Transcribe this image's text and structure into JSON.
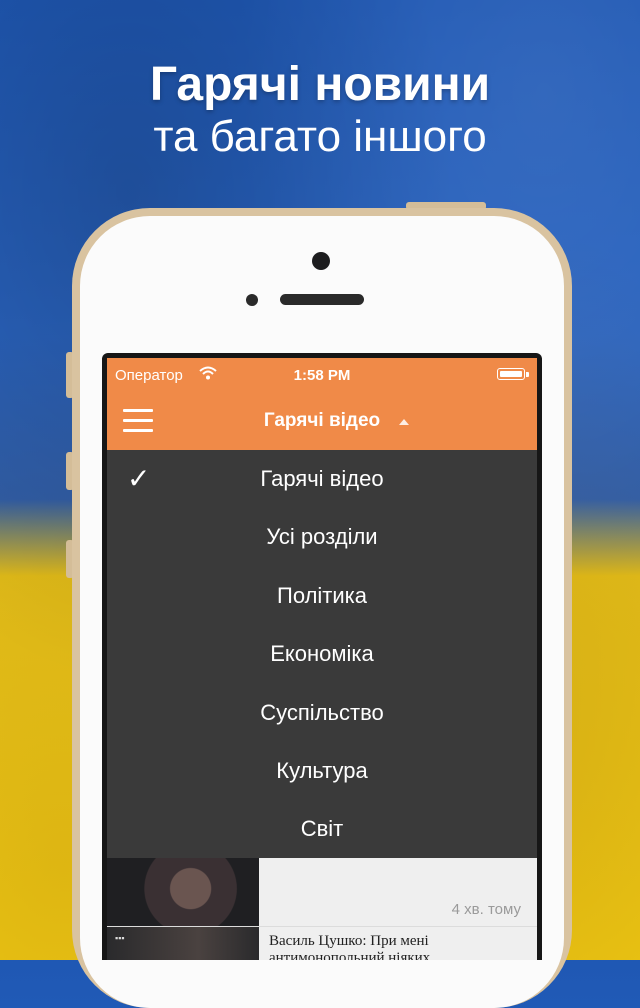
{
  "promo": {
    "headline_line1": "Гарячі новини",
    "headline_line2": "та багато іншого"
  },
  "status_bar": {
    "carrier": "Оператор",
    "time": "1:58 PM"
  },
  "nav": {
    "title": "Гарячі відео",
    "menu_icon": "hamburger-icon",
    "caret_icon": "caret-up-icon"
  },
  "category_menu": {
    "check_mark": "✓",
    "selected_index": 0,
    "items": [
      "Гарячі відео",
      "Усі розділи",
      "Політика",
      "Економіка",
      "Суспільство",
      "Культура",
      "Світ"
    ]
  },
  "news_list": [
    {
      "title": "",
      "time_ago": "4 хв. тому"
    },
    {
      "title": "Василь Цушко: При мені антимонопольний ніяких",
      "time_ago": ""
    }
  ],
  "colors": {
    "accent": "#f08a48",
    "menu_background": "#3a3a3a",
    "flag_blue": "#2a64c0",
    "flag_yellow": "#f2cc14"
  }
}
